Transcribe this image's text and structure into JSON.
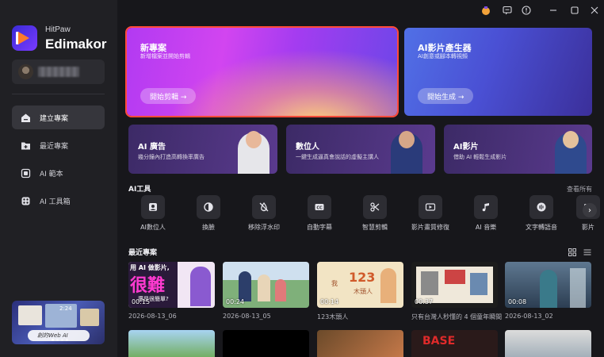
{
  "app": {
    "brand_top": "HitPaw",
    "brand_main": "Edimakor"
  },
  "sidebar": {
    "items": [
      {
        "label": "建立專案",
        "icon": "home-icon",
        "active": true
      },
      {
        "label": "最近專案",
        "icon": "folder-add-icon",
        "active": false
      },
      {
        "label": "AI 範本",
        "icon": "template-icon",
        "active": false
      },
      {
        "label": "AI 工具箱",
        "icon": "toolbox-icon",
        "active": false
      }
    ],
    "promo": {
      "time": "2:24",
      "pill": "創的Web AI"
    }
  },
  "hero": {
    "new_project": {
      "title": "新專案",
      "subtitle": "新增檔案並開始剪輯",
      "button": "開始剪輯 →"
    },
    "ai_video": {
      "title": "AI影片產生器",
      "subtitle": "AI創意或腳本轉視頻",
      "button": "開始生成 →"
    }
  },
  "features": [
    {
      "title": "AI 廣告",
      "subtitle": "幾分鐘內打造高轉換率廣告"
    },
    {
      "title": "數位人",
      "subtitle": "一鍵生成逼真會說話的虛擬主講人"
    },
    {
      "title": "AI影片",
      "subtitle": "借助 AI 輕鬆生成影片"
    }
  ],
  "ai_tools": {
    "title": "AI工具",
    "see_all": "查看所有",
    "items": [
      {
        "label": "AI數位人",
        "icon": "avatar-icon"
      },
      {
        "label": "換臉",
        "icon": "face-swap-icon"
      },
      {
        "label": "移除浮水印",
        "icon": "watermark-remove-icon"
      },
      {
        "label": "自動字幕",
        "icon": "subtitle-icon"
      },
      {
        "label": "智慧剪輯",
        "icon": "smart-cut-icon"
      },
      {
        "label": "影片畫質修復",
        "icon": "video-enhance-icon"
      },
      {
        "label": "AI 音樂",
        "icon": "music-icon"
      },
      {
        "label": "文字轉語音",
        "icon": "tts-icon"
      },
      {
        "label": "影片",
        "icon": "video-icon"
      }
    ]
  },
  "recent": {
    "title": "最近專案",
    "items": [
      {
        "duration": "00:15",
        "date": "2026-08-13_06",
        "caption_line1": "用 AI 做影片,",
        "caption_big": "很難",
        "caption_line2": "還是很簡單?"
      },
      {
        "duration": "00:24",
        "date": "2026-08-13_05"
      },
      {
        "duration": "00:14",
        "date": "123木頭人",
        "caption_big": "123",
        "caption_line1": "我",
        "caption_line2": "木頭人"
      },
      {
        "duration": "00:37",
        "date": "只有台灣人秒懂的 4 個童年瞬間"
      },
      {
        "duration": "00:08",
        "date": "2026-08-13_02"
      }
    ],
    "row2_caption": "BASE"
  }
}
